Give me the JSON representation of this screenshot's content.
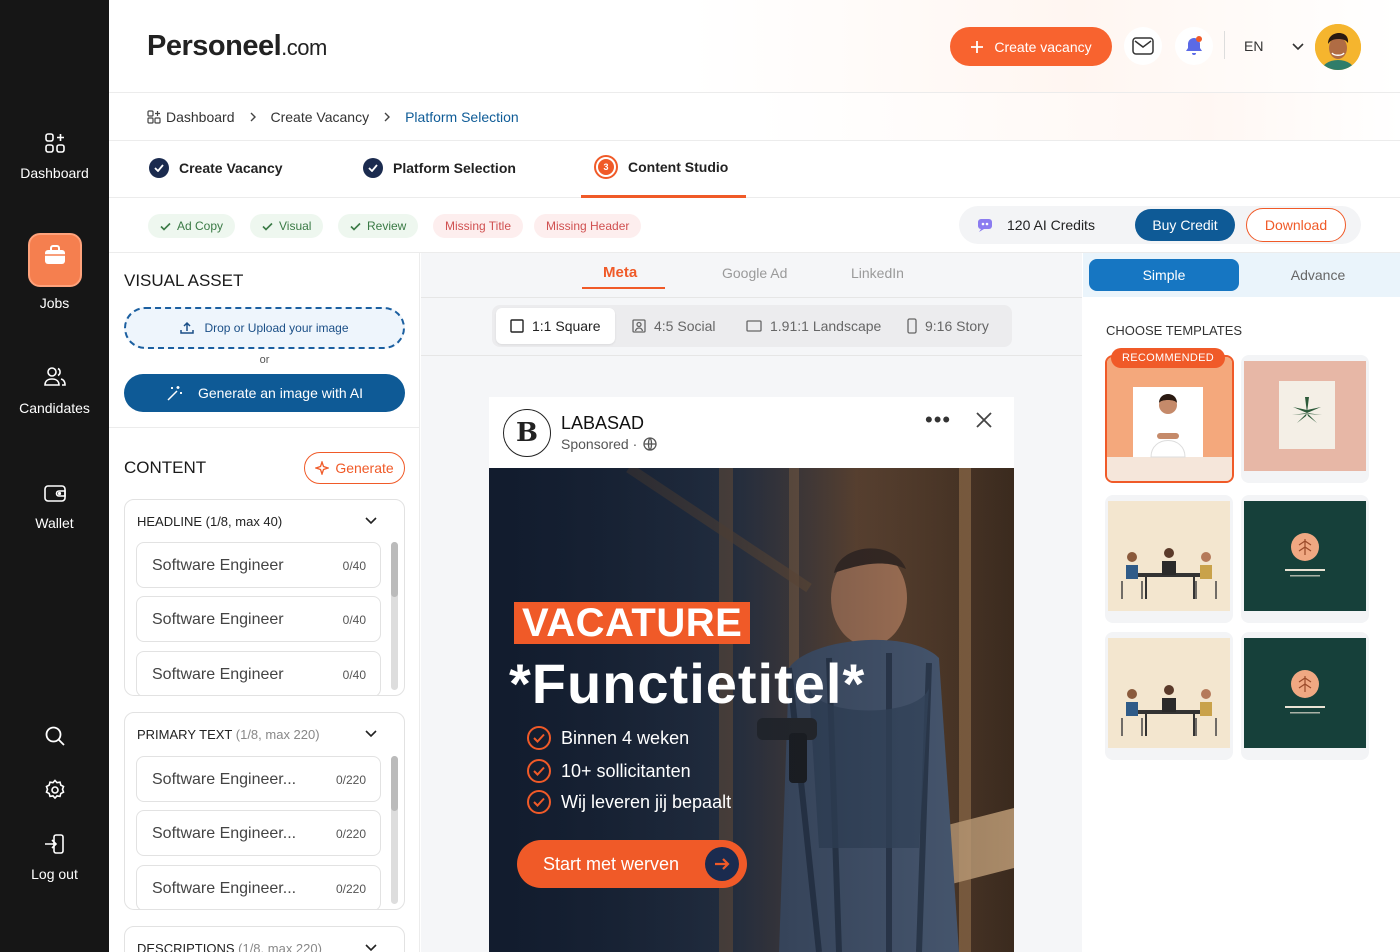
{
  "sidebar": {
    "items": [
      {
        "label": "Dashboard",
        "icon": "dashboard-icon"
      },
      {
        "label": "Jobs",
        "icon": "briefcase-icon",
        "active": true
      },
      {
        "label": "Candidates",
        "icon": "users-icon"
      },
      {
        "label": "Wallet",
        "icon": "wallet-icon"
      }
    ],
    "logout": "Log out"
  },
  "header": {
    "logo": "Personeel",
    "logo_suffix": ".com",
    "create_label": "Create vacancy",
    "language": "EN"
  },
  "breadcrumb": [
    "Dashboard",
    "Create Vacancy",
    "Platform Selection"
  ],
  "steps": [
    {
      "label": "Create Vacancy",
      "state": "done"
    },
    {
      "label": "Platform Selection",
      "state": "done"
    },
    {
      "label": "Content Studio",
      "state": "current",
      "number": "3"
    }
  ],
  "chips": [
    {
      "label": "Ad Copy",
      "status": "ok"
    },
    {
      "label": "Visual",
      "status": "ok"
    },
    {
      "label": "Review",
      "status": "ok"
    },
    {
      "label": "Missing Title",
      "status": "missing"
    },
    {
      "label": "Missing Header",
      "status": "missing"
    }
  ],
  "credits": {
    "label": "120 AI Credits",
    "buy": "Buy Credit",
    "download": "Download"
  },
  "left": {
    "visual_title": "VISUAL ASSET",
    "drop_label": "Drop or Upload your image",
    "or": "or",
    "generate_ai": "Generate an image with AI",
    "content_title": "CONTENT",
    "generate": "Generate",
    "headline": {
      "title": "HEADLINE (1/8, max 40)",
      "fields": [
        {
          "value": "Software Engineer",
          "count": "0/40"
        },
        {
          "value": "Software Engineer",
          "count": "0/40"
        },
        {
          "value": "Software Engineer",
          "count": "0/40"
        }
      ]
    },
    "primary": {
      "title": "PRIMARY TEXT",
      "meta": "(1/8, max 220)",
      "fields": [
        {
          "value": "Software Engineer...",
          "count": "0/220"
        },
        {
          "value": "Software Engineer...",
          "count": "0/220"
        },
        {
          "value": "Software Engineer...",
          "count": "0/220"
        }
      ]
    },
    "descriptions": {
      "title": "DESCRIPTIONS",
      "meta": "(1/8, max 220)"
    }
  },
  "center": {
    "tabs": [
      "Meta",
      "Google Ad",
      "LinkedIn"
    ],
    "active_tab": "Meta",
    "formats": [
      "1:1 Square",
      "4:5 Social",
      "1.91:1 Landscape",
      "9:16 Story"
    ],
    "active_format": "1:1 Square",
    "post": {
      "logo_letter": "B",
      "name": "LABASAD",
      "sponsored": "Sponsored ·",
      "badge": "VACATURE",
      "title": "*Functietitel*",
      "bullets": [
        "Binnen 4 weken",
        "10+ sollicitanten",
        "Wij leveren jij bepaalt"
      ],
      "cta": "Start met werven"
    }
  },
  "right": {
    "modes": [
      "Simple",
      "Advance"
    ],
    "active_mode": "Simple",
    "choose": "CHOOSE TEMPLATES",
    "recommended": "RECOMMENDED",
    "templates": [
      "person-portrait",
      "plant-poster",
      "meeting-illustration",
      "brand-assets-dark",
      "meeting-illustration",
      "brand-assets-dark"
    ]
  },
  "colors": {
    "accent": "#f05a28",
    "primary": "#0e5a96",
    "sidebar": "#161616"
  }
}
